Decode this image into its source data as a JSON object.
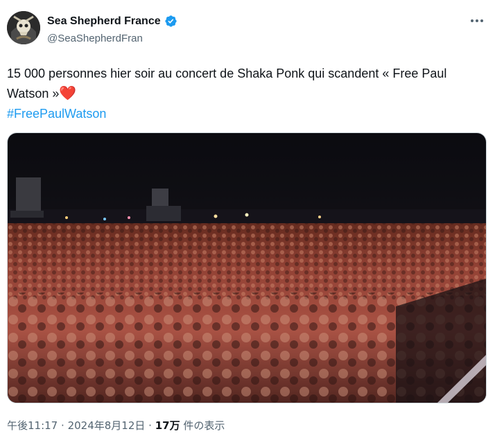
{
  "author": {
    "display_name": "Sea Shepherd France",
    "handle": "@SeaShepherdFran",
    "verified": true,
    "verified_color": "#1d9bf0"
  },
  "tweet": {
    "text": "15 000 personnes hier soir au concert de Shaka Ponk qui scandent « Free Paul Watson »",
    "emoji": "❤️",
    "hashtag": "#FreePaulWatson",
    "hashtag_color": "#1d9bf0"
  },
  "media": {
    "description_icon": "concert-crowd-photo"
  },
  "meta": {
    "time": "午後11:17",
    "separator": "·",
    "date": "2024年8月12日",
    "views_count": "17万",
    "views_label": "件の表示"
  },
  "icons": {
    "more": "more-options-icon",
    "verified": "verified-badge-icon"
  }
}
